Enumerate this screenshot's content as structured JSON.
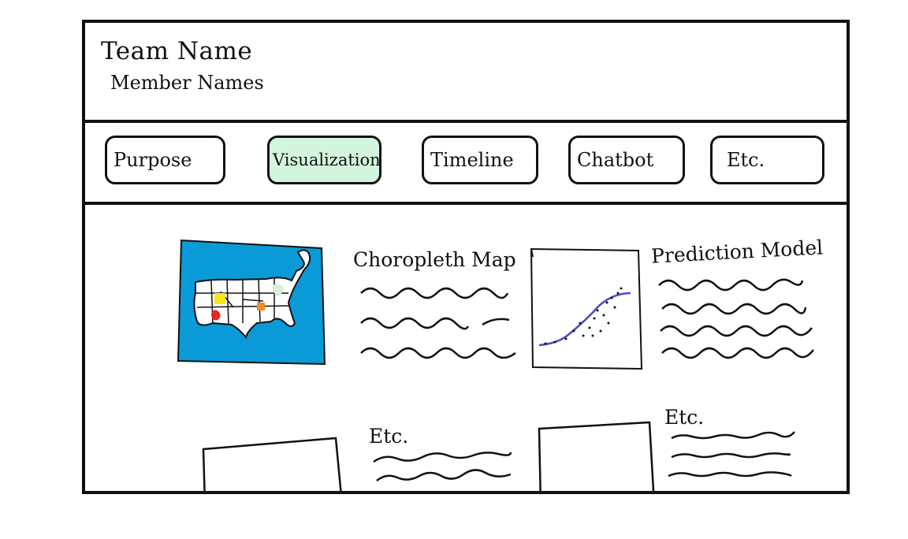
{
  "header": {
    "team_name": "Team Name",
    "member_names": "Member Names"
  },
  "tabs": [
    {
      "label": "Purpose",
      "active": false
    },
    {
      "label": "Visualizations",
      "active": true
    },
    {
      "label": "Timeline",
      "active": false
    },
    {
      "label": "Chatbot",
      "active": false
    },
    {
      "label": "Etc.",
      "active": false
    }
  ],
  "cards": [
    {
      "title": "Choropleth Map",
      "thumbnail": "us-choropleth-map-icon"
    },
    {
      "title": "Prediction Model",
      "thumbnail": "scatter-plot-icon"
    },
    {
      "title": "Etc.",
      "thumbnail": "placeholder-image"
    },
    {
      "title": "Etc.",
      "thumbnail": "placeholder-image"
    }
  ],
  "colors": {
    "active_tab": "#d3f4dd",
    "map_background": "#0a9ad8",
    "trend_line": "#4a4ac8",
    "highlight_yellow": "#f4e81c",
    "highlight_red": "#e02828",
    "highlight_orange": "#f08a2a",
    "highlight_green": "#d9eedd"
  }
}
